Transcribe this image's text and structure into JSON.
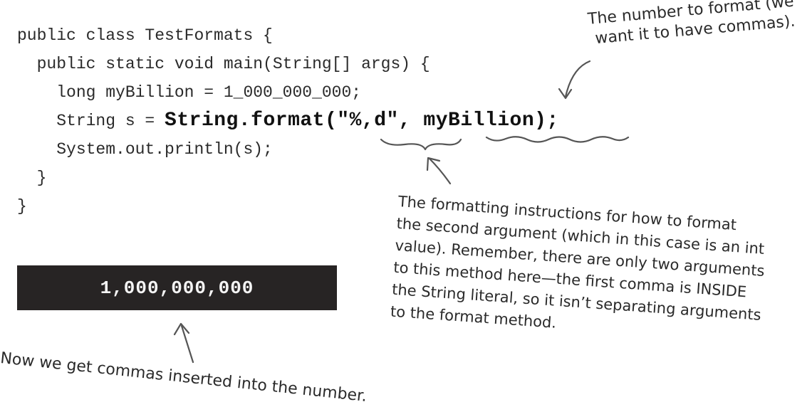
{
  "code": {
    "lines": [
      "public class TestFormats {",
      "  public static void main(String[] args) {",
      "    long myBillion = 1_000_000_000;",
      "    String s = ",
      "    System.out.println(s);",
      "  }",
      "}"
    ],
    "format_call": "String.format(\"%,d\", myBillion);"
  },
  "output": {
    "value": "1,000,000,000"
  },
  "annotations": {
    "number_note": [
      "The number to format (we",
      "want it to have commas)."
    ],
    "format_note": [
      "The formatting instructions for how to format",
      "the second argument (which in this case is an int",
      "value). Remember, there are only two arguments",
      "to this method here—the first comma is INSIDE",
      "the String literal, so it isn’t separating arguments",
      "to the format method."
    ],
    "output_note": "Now we get commas inserted into the number."
  }
}
